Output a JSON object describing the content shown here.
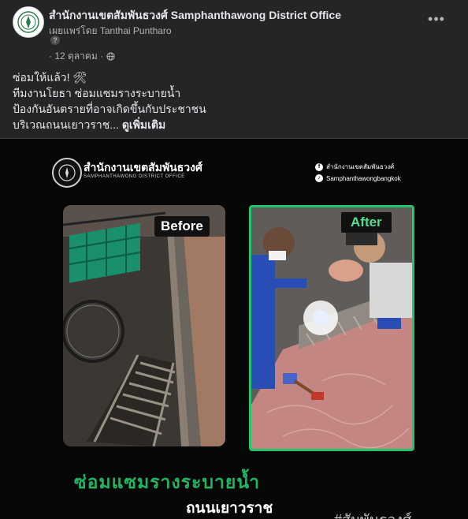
{
  "post": {
    "page_name": "สำนักงานเขตสัมพันธวงศ์ Samphanthawong District Office",
    "published_by": "เผยแพร่โดย Tanthai Puntharo",
    "help_mark": "?",
    "date": "· 12 ตุลาคม ·",
    "more_label": "•••",
    "audience_icon": "globe-icon",
    "caption_lines": [
      "ซ่อมให้แล้ว! 🛠",
      "ทีมงานโยธา ซ่อมแซมรางระบายน้ำ",
      "ป้องกันอันตรายที่อาจเกิดขึ้นกับประชาชน",
      "บริเวณถนนเยาวราช..."
    ],
    "see_more": "ดูเพิ่มเติม"
  },
  "image": {
    "office_th": "สำนักงานเขตสัมพันธวงศ์",
    "office_en": "SAMPHANTHAWONG DISTRICT OFFICE",
    "facebook_name": "สำนักงานเขตสัมพันธวงศ์",
    "tiktok_name": "Samphanthawongbangkok",
    "before_label": "Before",
    "after_label": "After",
    "title": "ซ่อมแซมรางระบายน้ำ",
    "road": "ถนนเยาวราช",
    "hashtag": "#สัมพันธวงศ์"
  },
  "colors": {
    "background": "#242526",
    "accent_green": "#25c36a"
  }
}
